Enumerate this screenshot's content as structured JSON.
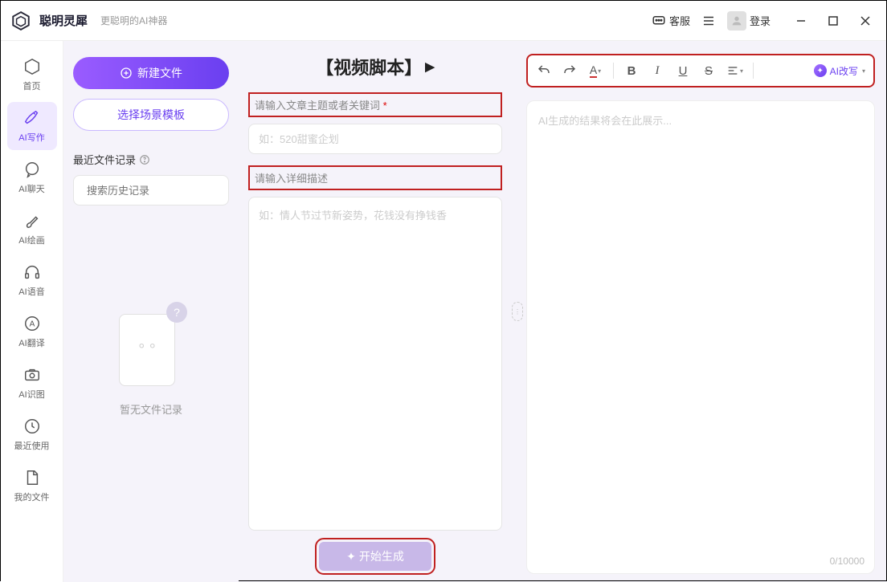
{
  "titlebar": {
    "app_name": "聪明灵犀",
    "app_sub": "更聪明的AI神器",
    "service": "客服",
    "login": "登录"
  },
  "nav": {
    "items": [
      {
        "label": "首页",
        "name": "home"
      },
      {
        "label": "AI写作",
        "name": "ai-writing"
      },
      {
        "label": "AI聊天",
        "name": "ai-chat"
      },
      {
        "label": "AI绘画",
        "name": "ai-drawing"
      },
      {
        "label": "AI语音",
        "name": "ai-voice"
      },
      {
        "label": "AI翻译",
        "name": "ai-translate"
      },
      {
        "label": "AI识图",
        "name": "ai-image-rec"
      },
      {
        "label": "最近使用",
        "name": "recent"
      },
      {
        "label": "我的文件",
        "name": "my-files"
      }
    ]
  },
  "filepanel": {
    "new_file": "新建文件",
    "choose_template": "选择场景模板",
    "recent_label": "最近文件记录",
    "search_ph": "搜索历史记录",
    "empty_text": "暂无文件记录"
  },
  "center": {
    "title": "【视频脚本】",
    "label1": "请输入文章主题或者关键词",
    "input1_ph": "如：520甜蜜企划",
    "label2": "请输入详细描述",
    "input2_ph": "如：情人节过节新姿势，花钱没有挣钱香",
    "gen_btn": "开始生成"
  },
  "toolbar": {
    "ai_rewrite": "AI改写"
  },
  "output": {
    "placeholder": "AI生成的结果将会在此展示...",
    "counter": "0/10000"
  }
}
